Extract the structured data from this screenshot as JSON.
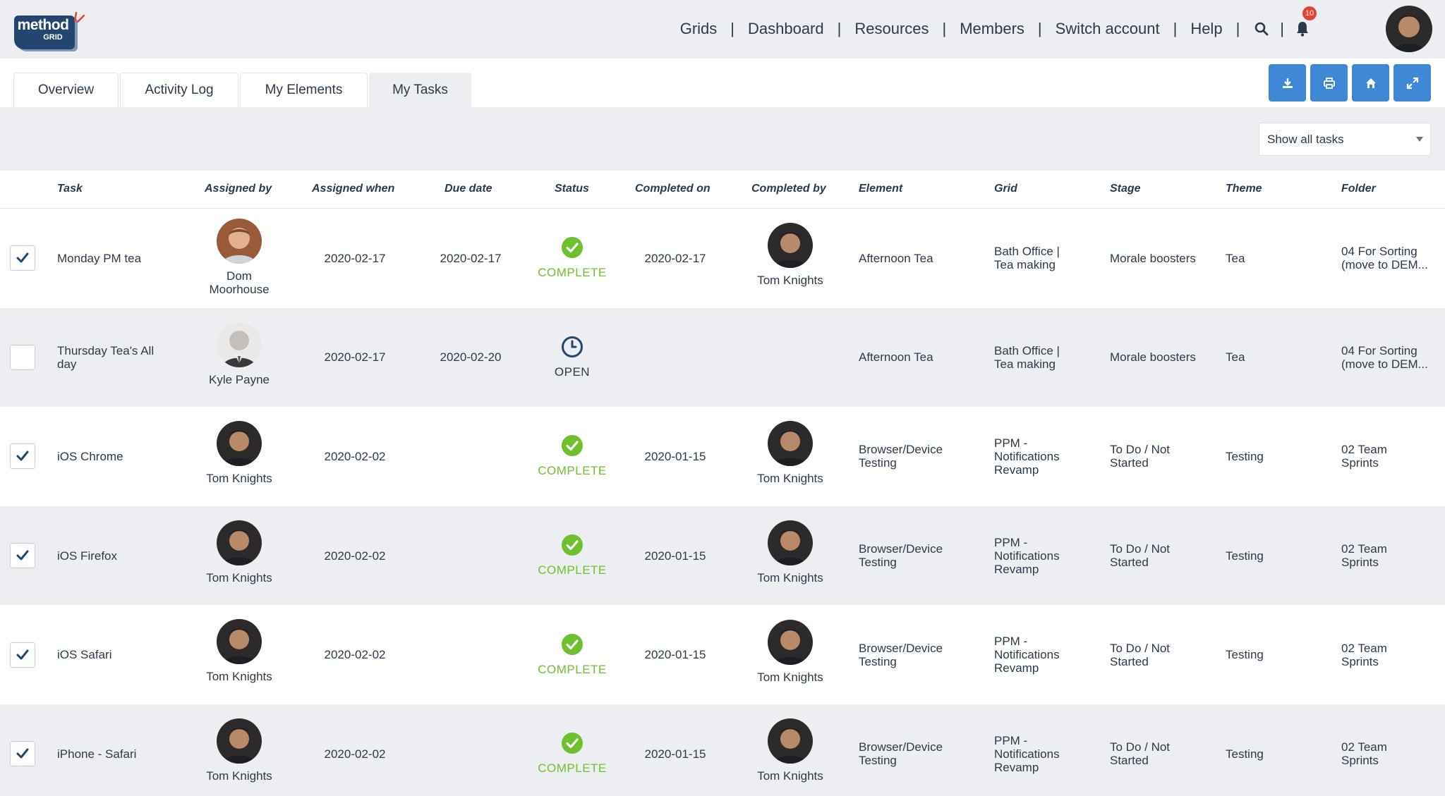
{
  "brand": {
    "word": "method",
    "sub": "GRID"
  },
  "nav": {
    "items": [
      "Grids",
      "Dashboard",
      "Resources",
      "Members",
      "Switch account",
      "Help"
    ],
    "notification_count": "10"
  },
  "tabs": [
    {
      "label": "Overview",
      "active": false
    },
    {
      "label": "Activity Log",
      "active": false
    },
    {
      "label": "My Elements",
      "active": false
    },
    {
      "label": "My Tasks",
      "active": true
    }
  ],
  "toolbar": [
    "download-icon",
    "print-icon",
    "home-icon",
    "expand-icon"
  ],
  "filter": {
    "selected": "Show all tasks"
  },
  "columns": [
    "Task",
    "Assigned by",
    "Assigned when",
    "Due date",
    "Status",
    "Completed on",
    "Completed by",
    "Element",
    "Grid",
    "Stage",
    "Theme",
    "Folder"
  ],
  "rows": [
    {
      "checked": true,
      "task": [
        "Monday PM tea"
      ],
      "assigned_by": [
        "Dom",
        "Moorhouse"
      ],
      "assigned_by_avatar": "dom",
      "assigned_when": "2020-02-17",
      "due": "2020-02-17",
      "status": "COMPLETE",
      "completed_on": "2020-02-17",
      "completed_by": "Tom Knights",
      "element": [
        "Afternoon Tea"
      ],
      "grid": [
        "Bath Office |",
        "Tea making"
      ],
      "stage": [
        "Morale boosters"
      ],
      "theme": "Tea",
      "folder": [
        "04 For Sorting",
        "(move to DEM..."
      ]
    },
    {
      "checked": false,
      "task": [
        "Thursday Tea's All",
        "day"
      ],
      "assigned_by": [
        "Kyle Payne"
      ],
      "assigned_by_avatar": "kyle",
      "assigned_when": "2020-02-17",
      "due": "2020-02-20",
      "status": "OPEN",
      "completed_on": "",
      "completed_by": "",
      "element": [
        "Afternoon Tea"
      ],
      "grid": [
        "Bath Office |",
        "Tea making"
      ],
      "stage": [
        "Morale boosters"
      ],
      "theme": "Tea",
      "folder": [
        "04 For Sorting",
        "(move to DEM..."
      ]
    },
    {
      "checked": true,
      "task": [
        "iOS Chrome"
      ],
      "assigned_by": [
        "Tom Knights"
      ],
      "assigned_by_avatar": "tom",
      "assigned_when": "2020-02-02",
      "due": "",
      "status": "COMPLETE",
      "completed_on": "2020-01-15",
      "completed_by": "Tom Knights",
      "element": [
        "Browser/Device",
        "Testing"
      ],
      "grid": [
        "PPM -",
        "Notifications",
        "Revamp"
      ],
      "stage": [
        "To Do / Not",
        "Started"
      ],
      "theme": "Testing",
      "folder": [
        "02 Team",
        "Sprints"
      ]
    },
    {
      "checked": true,
      "task": [
        "iOS Firefox"
      ],
      "assigned_by": [
        "Tom Knights"
      ],
      "assigned_by_avatar": "tom",
      "assigned_when": "2020-02-02",
      "due": "",
      "status": "COMPLETE",
      "completed_on": "2020-01-15",
      "completed_by": "Tom Knights",
      "element": [
        "Browser/Device",
        "Testing"
      ],
      "grid": [
        "PPM -",
        "Notifications",
        "Revamp"
      ],
      "stage": [
        "To Do / Not",
        "Started"
      ],
      "theme": "Testing",
      "folder": [
        "02 Team",
        "Sprints"
      ]
    },
    {
      "checked": true,
      "task": [
        "iOS Safari"
      ],
      "assigned_by": [
        "Tom Knights"
      ],
      "assigned_by_avatar": "tom",
      "assigned_when": "2020-02-02",
      "due": "",
      "status": "COMPLETE",
      "completed_on": "2020-01-15",
      "completed_by": "Tom Knights",
      "element": [
        "Browser/Device",
        "Testing"
      ],
      "grid": [
        "PPM -",
        "Notifications",
        "Revamp"
      ],
      "stage": [
        "To Do / Not",
        "Started"
      ],
      "theme": "Testing",
      "folder": [
        "02 Team",
        "Sprints"
      ]
    },
    {
      "checked": true,
      "task": [
        "iPhone - Safari"
      ],
      "assigned_by": [
        "Tom Knights"
      ],
      "assigned_by_avatar": "tom",
      "assigned_when": "2020-02-02",
      "due": "",
      "status": "COMPLETE",
      "completed_on": "2020-01-15",
      "completed_by": "Tom Knights",
      "element": [
        "Browser/Device",
        "Testing"
      ],
      "grid": [
        "PPM -",
        "Notifications",
        "Revamp"
      ],
      "stage": [
        "To Do / Not",
        "Started"
      ],
      "theme": "Testing",
      "folder": [
        "02 Team",
        "Sprints"
      ]
    }
  ],
  "colors": {
    "accent": "#3f88d6",
    "complete": "#6fbf2f",
    "brand": "#24466e",
    "badge": "#e8413a"
  }
}
